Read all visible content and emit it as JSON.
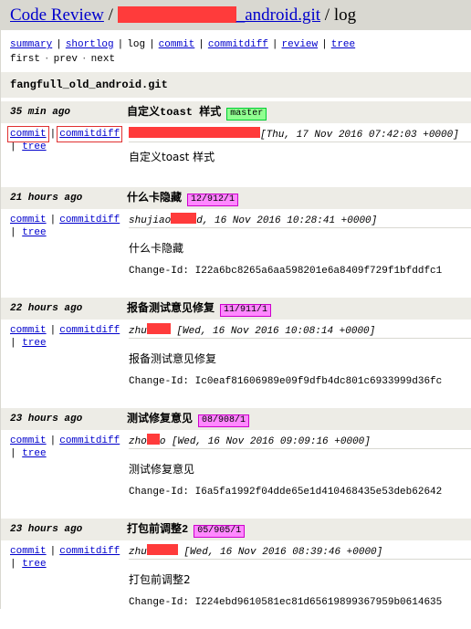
{
  "header": {
    "site_link": "Code Review",
    "separator": "/",
    "repo_link_suffix": "_android.git",
    "separator2": "/",
    "action": "log"
  },
  "nav": {
    "items": [
      {
        "label": "summary",
        "link": true
      },
      {
        "label": "shortlog",
        "link": true
      },
      {
        "label": "log",
        "link": false
      },
      {
        "label": "commit",
        "link": true
      },
      {
        "label": "commitdiff",
        "link": true
      },
      {
        "label": "review",
        "link": true
      },
      {
        "label": "tree",
        "link": true
      }
    ],
    "sep": "|",
    "paging": {
      "first": "first",
      "prev": "prev",
      "next": "next",
      "dot": "·"
    }
  },
  "project": {
    "title": "fangfull_old_android.git"
  },
  "entries": [
    {
      "age": "35 min ago",
      "subject": "自定义toast 样式",
      "tag": "master",
      "tag_type": "head",
      "author_date": "[Thu, 17 Nov 2016 07:42:03 +0000]",
      "message": "自定义toast 样式",
      "change_id": "",
      "links": {
        "commit": "commit",
        "commitdiff": "commitdiff",
        "tree": "tree",
        "sep": "|"
      }
    },
    {
      "age": "21 hours ago",
      "subject": "什么卡隐藏",
      "tag": "12/912/1",
      "tag_type": "ref",
      "author_prefix": "shujiao",
      "author_date": "d, 16 Nov 2016 10:28:41 +0000]",
      "message": "什么卡隐藏",
      "change_id": "Change-Id: I22a6bc8265a6aa598201e6a8409f729f1bfddfc1",
      "links": {
        "commit": "commit",
        "commitdiff": "commitdiff",
        "tree": "tree",
        "sep": "|"
      }
    },
    {
      "age": "22 hours ago",
      "subject": "报备测试意见修复",
      "tag": "11/911/1",
      "tag_type": "ref",
      "author_prefix": "zhu",
      "author_date": "[Wed, 16 Nov 2016 10:08:14 +0000]",
      "message": "报备测试意见修复",
      "change_id": "Change-Id: Ic0eaf81606989e09f9dfb4dc801c6933999d36fc",
      "links": {
        "commit": "commit",
        "commitdiff": "commitdiff",
        "tree": "tree",
        "sep": "|"
      }
    },
    {
      "age": "23 hours ago",
      "subject": "测试修复意见",
      "tag": "08/908/1",
      "tag_type": "ref",
      "author_prefix": "zho",
      "author_suffix": "o",
      "author_date": "[Wed, 16 Nov 2016 09:09:16 +0000]",
      "message": "测试修复意见",
      "change_id": "Change-Id: I6a5fa1992f04dde65e1d410468435e53deb62642",
      "links": {
        "commit": "commit",
        "commitdiff": "commitdiff",
        "tree": "tree",
        "sep": "|"
      }
    },
    {
      "age": "23 hours ago",
      "subject": "打包前调整2",
      "tag": "05/905/1",
      "tag_type": "ref",
      "author_prefix": "zhu",
      "author_date": "[Wed, 16 Nov 2016 08:39:46 +0000]",
      "message": "打包前调整2",
      "change_id": "Change-Id: I224ebd9610581ec81d65619899367959b0614635",
      "links": {
        "commit": "commit",
        "commitdiff": "commitdiff",
        "tree": "tree",
        "sep": "|"
      }
    }
  ],
  "colors": {
    "header_bg": "#d9d8d1",
    "row_bg": "#edece6",
    "link": "#0000cc",
    "head_tag_bg": "#90ff90",
    "ref_tag_bg": "#ff88ff",
    "redaction": "#ff3b3b",
    "highlight_box": "#e03030"
  }
}
